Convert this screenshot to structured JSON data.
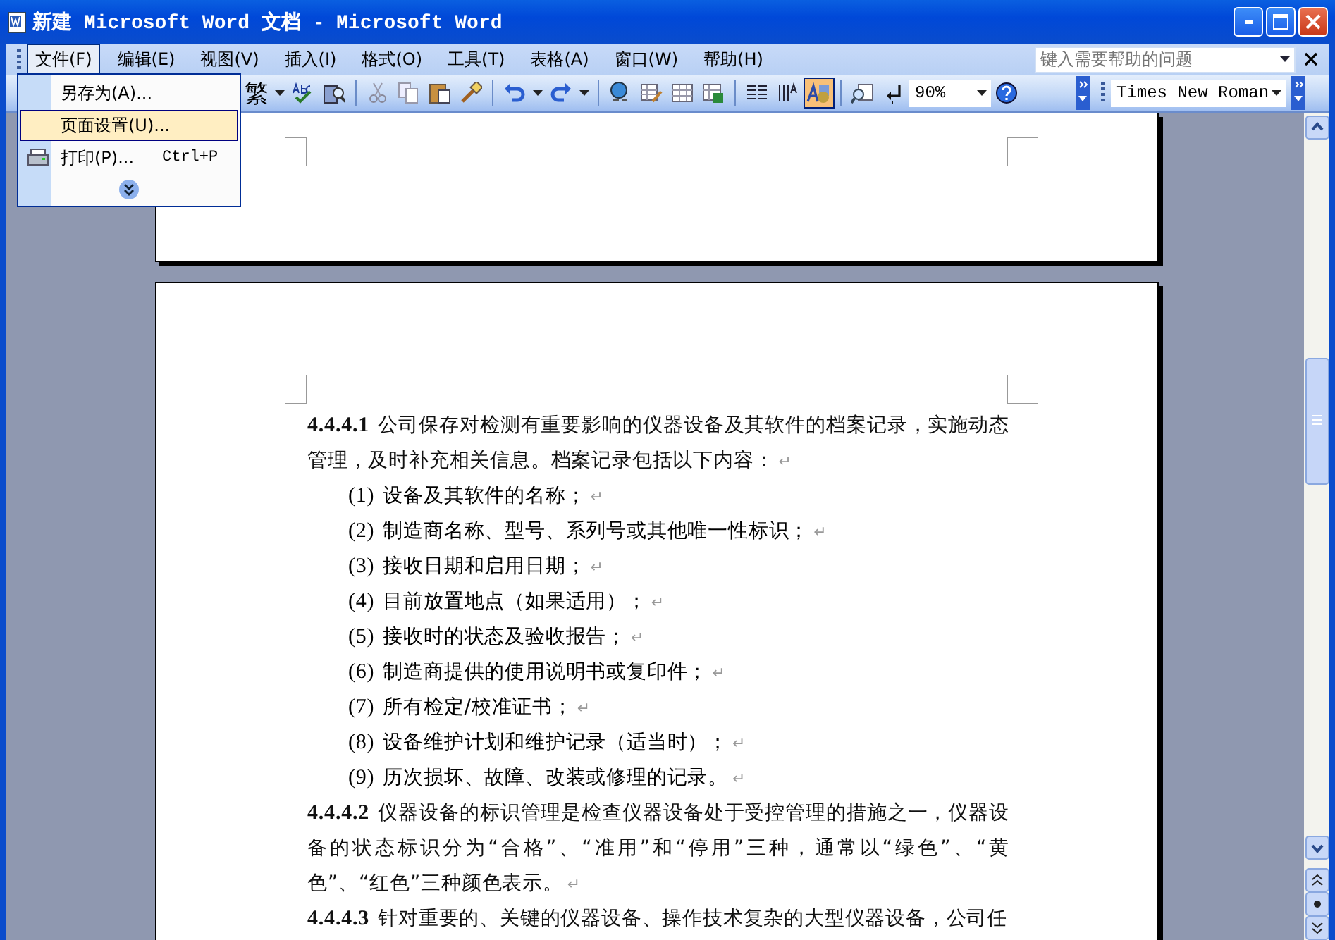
{
  "window": {
    "title": "新建 Microsoft Word 文档 - Microsoft Word"
  },
  "menu_bar": {
    "items": [
      {
        "label": "文件(F)",
        "selected": true
      },
      {
        "label": "编辑(E)",
        "selected": false
      },
      {
        "label": "视图(V)",
        "selected": false
      },
      {
        "label": "插入(I)",
        "selected": false
      },
      {
        "label": "格式(O)",
        "selected": false
      },
      {
        "label": "工具(T)",
        "selected": false
      },
      {
        "label": "表格(A)",
        "selected": false
      },
      {
        "label": "窗口(W)",
        "selected": false
      },
      {
        "label": "帮助(H)",
        "selected": false
      }
    ],
    "help_box": {
      "placeholder": "键入需要帮助的问题"
    }
  },
  "file_menu": {
    "items": [
      {
        "label": "另存为(A)...",
        "selected": false,
        "icon": false
      },
      {
        "label": "页面设置(U)...",
        "selected": true,
        "icon": false
      },
      {
        "label": "打印(P)...",
        "shortcut": "Ctrl+P",
        "selected": false,
        "icon": true
      }
    ]
  },
  "toolbar": {
    "script_button": "繁",
    "drawing_button": {
      "pressed": true
    },
    "zoom": "90%",
    "font": "Times New Roman"
  },
  "document": {
    "paragraphs": [
      {
        "kind": "clause",
        "number": "4.4.4.1",
        "text": "公司保存对检测有重要影响的仪器设备及其软件的档案记录，实施动态管理，及时补充相关信息。档案记录包括以下内容：",
        "end_mark": "↵"
      },
      {
        "kind": "item",
        "number": "(1)",
        "text": "设备及其软件的名称；",
        "end_mark": "↵"
      },
      {
        "kind": "item",
        "number": "(2)",
        "text": "制造商名称、型号、系列号或其他唯一性标识；",
        "end_mark": "↵"
      },
      {
        "kind": "item",
        "number": "(3)",
        "text": "接收日期和启用日期；",
        "end_mark": "↵"
      },
      {
        "kind": "item",
        "number": "(4)",
        "text": "目前放置地点（如果适用）；",
        "end_mark": "↵"
      },
      {
        "kind": "item",
        "number": "(5)",
        "text": "接收时的状态及验收报告；",
        "end_mark": "↵"
      },
      {
        "kind": "item",
        "number": "(6)",
        "text": "制造商提供的使用说明书或复印件；",
        "end_mark": "↵"
      },
      {
        "kind": "item",
        "number": "(7)",
        "text": "所有检定/校准证书；",
        "end_mark": "↵"
      },
      {
        "kind": "item",
        "number": "(8)",
        "text": "设备维护计划和维护记录（适当时）；",
        "end_mark": "↵"
      },
      {
        "kind": "item",
        "number": "(9)",
        "text": "历次损坏、故障、改装或修理的记录。",
        "end_mark": "↵"
      },
      {
        "kind": "clause",
        "number": "4.4.4.2",
        "text": "仪器设备的标识管理是检查仪器设备处于受控管理的措施之一，仪器设备的状态标识分为“合格”、“准用”和“停用”三种，通常以“绿色”、“黄色”、“红色”三种颜色表示。",
        "end_mark": "↵"
      },
      {
        "kind": "clause",
        "number": "4.4.4.3",
        "text": "针对重要的、关键的仪器设备、操作技术复杂的大型仪器设备，公司任"
      }
    ]
  }
}
